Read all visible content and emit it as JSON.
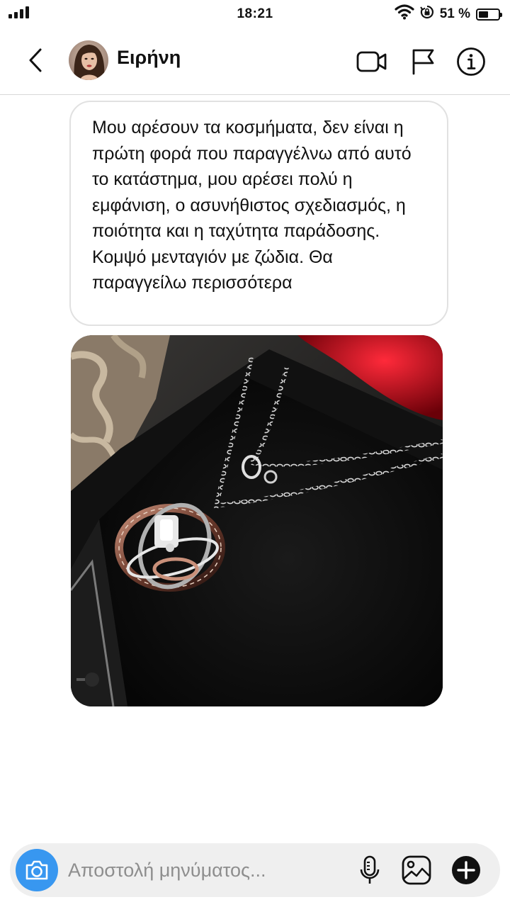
{
  "status_bar": {
    "time": "18:21",
    "battery_percent": "51 %",
    "battery_level": 0.51,
    "icons": [
      "signal-icon",
      "wifi-icon",
      "orientation-lock-icon",
      "battery-icon"
    ]
  },
  "header": {
    "contact_name": "Ειρήνη",
    "icons": [
      "back-arrow-icon",
      "video-camera-icon",
      "flag-icon",
      "info-icon"
    ]
  },
  "messages": [
    {
      "type": "text",
      "text": "Μου αρέσουν τα κοσμήματα, δεν είναι η πρώτη φορά που παραγγέλνω από αυτό το κατάστημα, μου αρέσει πολύ η εμφάνιση, ο ασυνήθιστος σχεδιασμός, η ποιότητα και η ταχύτητα παράδοσης. Κομψό μενταγιόν με ζώδια. Θα παραγγείλω περισσότερα"
    },
    {
      "type": "photo",
      "subject": "necklace-photo"
    }
  ],
  "composer": {
    "placeholder": "Αποστολή μηνύματος...",
    "value": "",
    "icons": [
      "camera-icon",
      "microphone-icon",
      "gallery-icon",
      "plus-icon"
    ]
  },
  "colors": {
    "accent": "#3897f0",
    "bubble_border": "#e1e1e1",
    "composer_bg": "#efefef",
    "placeholder": "#8e8e8e"
  }
}
